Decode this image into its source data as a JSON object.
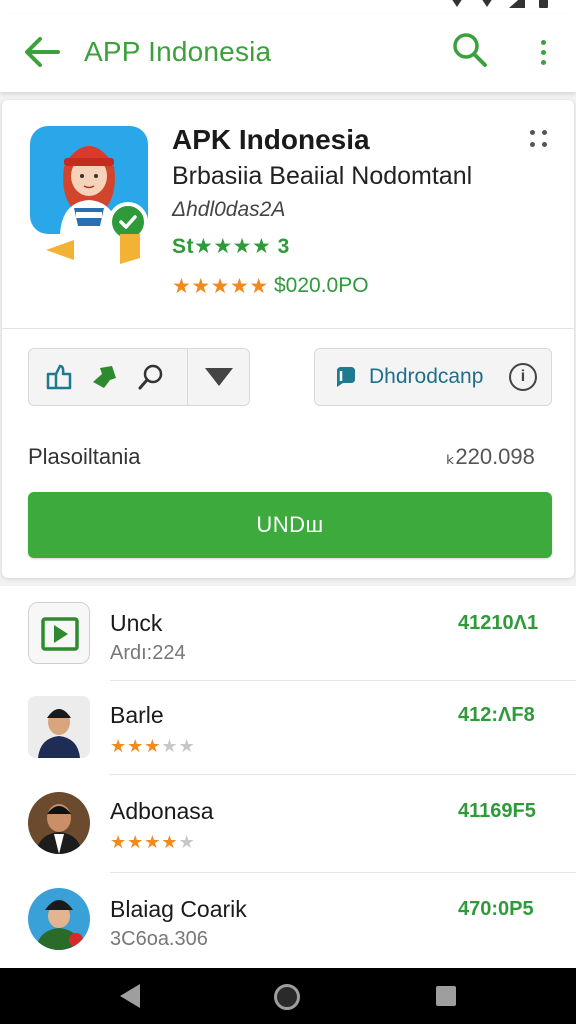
{
  "appbar": {
    "title": "APP Indonesia"
  },
  "app": {
    "name": "APK Indonesia",
    "developer": "Brbasiia Beaiial Nodomtanl",
    "id": "Δhdl0das2A",
    "rating_text": "St★★★★ 3",
    "price_stars": "★★★★★",
    "price": "$020.0PO"
  },
  "actions": {
    "download_label": "Dhdrodcanp",
    "info_symbol": "i"
  },
  "price_row": {
    "label": "Plasoiltania",
    "value": "ₖ220.098"
  },
  "install": {
    "label": "UNDш"
  },
  "list": [
    {
      "title": "Unck",
      "subtitle": "Ardı:224",
      "value": "41210Λ1"
    },
    {
      "title": "Barle",
      "stars": 3,
      "value": "412:ΛF8"
    },
    {
      "title": "Adbonasa",
      "stars": 4,
      "value": "41169F5"
    },
    {
      "title": "Blaiag Coarik",
      "subtitle": "3C6oa.306",
      "value": "470:0P5"
    }
  ],
  "colors": {
    "accent": "#3ba13b",
    "install_button": "#3caa3c",
    "star": "#f08a1e",
    "app_icon_bg": "#29a7e8"
  },
  "icons": {
    "back": "arrow-left-icon",
    "search": "search-icon",
    "more": "more-vert-icon",
    "verified": "check-badge-icon",
    "share": "share-icon",
    "pin": "pin-icon",
    "zoom": "magnifier-icon",
    "dropdown": "caret-down-icon",
    "download": "download-icon",
    "info": "info-icon"
  }
}
